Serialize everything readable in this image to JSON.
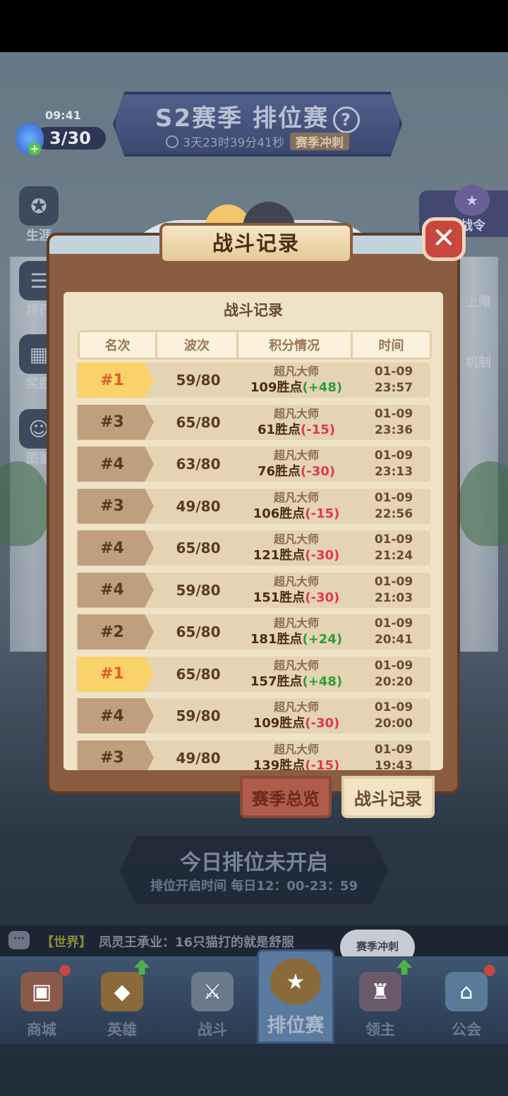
{
  "status": {
    "time": "09:41",
    "energy": "3/30"
  },
  "season_banner": {
    "title": "S2赛季 排位赛",
    "help": "?",
    "countdown": "3天23时39分41秒",
    "tag": "赛季冲刺"
  },
  "left_menu": [
    {
      "label": "生涯",
      "icon": "career-icon"
    },
    {
      "label": "排行",
      "icon": "leaderboard-icon"
    },
    {
      "label": "奖励",
      "icon": "reward-icon"
    },
    {
      "label": "图鉴",
      "icon": "codex-icon"
    }
  ],
  "right_menu": {
    "season_pass": "赛季战令",
    "limit": "上限",
    "mechanic": "机制"
  },
  "modal": {
    "title": "战斗记录",
    "close": "✕",
    "panel_title": "战斗记录",
    "columns": [
      "名次",
      "波次",
      "积分情况",
      "时间"
    ],
    "records": [
      {
        "rank": "#1",
        "gold": true,
        "wave": "59/80",
        "tier": "超凡大师",
        "points": "109胜点",
        "delta": "(+48)",
        "positive": true,
        "date": "01-09",
        "time": "23:57"
      },
      {
        "rank": "#3",
        "gold": false,
        "wave": "65/80",
        "tier": "超凡大师",
        "points": "61胜点",
        "delta": "(-15)",
        "positive": false,
        "date": "01-09",
        "time": "23:36"
      },
      {
        "rank": "#4",
        "gold": false,
        "wave": "63/80",
        "tier": "超凡大师",
        "points": "76胜点",
        "delta": "(-30)",
        "positive": false,
        "date": "01-09",
        "time": "23:13"
      },
      {
        "rank": "#3",
        "gold": false,
        "wave": "49/80",
        "tier": "超凡大师",
        "points": "106胜点",
        "delta": "(-15)",
        "positive": false,
        "date": "01-09",
        "time": "22:56"
      },
      {
        "rank": "#4",
        "gold": false,
        "wave": "65/80",
        "tier": "超凡大师",
        "points": "121胜点",
        "delta": "(-30)",
        "positive": false,
        "date": "01-09",
        "time": "21:24"
      },
      {
        "rank": "#4",
        "gold": false,
        "wave": "59/80",
        "tier": "超凡大师",
        "points": "151胜点",
        "delta": "(-30)",
        "positive": false,
        "date": "01-09",
        "time": "21:03"
      },
      {
        "rank": "#2",
        "gold": false,
        "wave": "65/80",
        "tier": "超凡大师",
        "points": "181胜点",
        "delta": "(+24)",
        "positive": true,
        "date": "01-09",
        "time": "20:41"
      },
      {
        "rank": "#1",
        "gold": true,
        "wave": "65/80",
        "tier": "超凡大师",
        "points": "157胜点",
        "delta": "(+48)",
        "positive": true,
        "date": "01-09",
        "time": "20:20"
      },
      {
        "rank": "#4",
        "gold": false,
        "wave": "59/80",
        "tier": "超凡大师",
        "points": "109胜点",
        "delta": "(-30)",
        "positive": false,
        "date": "01-09",
        "time": "20:00"
      },
      {
        "rank": "#3",
        "gold": false,
        "wave": "49/80",
        "tier": "超凡大师",
        "points": "139胜点",
        "delta": "(-15)",
        "positive": false,
        "date": "01-09",
        "time": "19:43"
      }
    ],
    "tabs": {
      "overview": "赛季总览",
      "records": "战斗记录"
    }
  },
  "today": {
    "title": "今日排位未开启",
    "subtitle": "排位开启时间 每日12：00-23：59"
  },
  "chat": {
    "channel": "【世界】",
    "message": "凤灵王承业：16只猫打的就是舒服",
    "bubble": "赛季冲刺"
  },
  "nav": [
    {
      "label": "商城",
      "icon": "shop-icon"
    },
    {
      "label": "英雄",
      "icon": "hero-icon"
    },
    {
      "label": "战斗",
      "icon": "battle-icon"
    },
    {
      "label": "排位赛",
      "icon": "ranked-icon",
      "active": true
    },
    {
      "label": "领主",
      "icon": "lord-icon"
    },
    {
      "label": "公会",
      "icon": "guild-icon"
    }
  ],
  "colors": {
    "positive": "#2e9b3c",
    "negative": "#e0384a",
    "gold_rank": "#f9d26a",
    "modal_frame": "#8a5c40"
  }
}
